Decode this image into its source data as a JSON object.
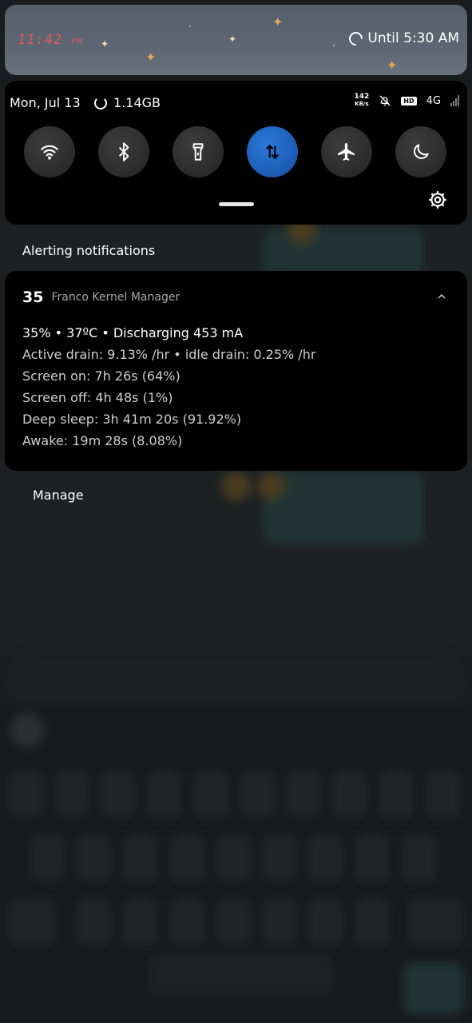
{
  "header": {
    "clock_time": "11:42",
    "clock_ampm": "PM",
    "alarm_text": "Until 5:30 AM"
  },
  "quick_settings": {
    "date": "Mon, Jul 13",
    "memory": "1.14GB",
    "net_speed_value": "142",
    "net_speed_unit": "KB/s",
    "hd_badge": "HD",
    "network_type": "4G",
    "tiles": [
      {
        "name": "wifi",
        "active": false
      },
      {
        "name": "bluetooth",
        "active": false
      },
      {
        "name": "flashlight",
        "active": false
      },
      {
        "name": "mobile-data",
        "active": true
      },
      {
        "name": "airplane-mode",
        "active": false
      },
      {
        "name": "dark-mode",
        "active": false
      }
    ],
    "accent_color": "#1e5fba"
  },
  "notifications": {
    "section_title": "Alerting notifications",
    "card": {
      "number": "35",
      "app_name": "Franco Kernel Manager",
      "lines": [
        "35% • 37ºC • Discharging 453 mA",
        "Active drain: 9.13% /hr • idle drain: 0.25% /hr",
        "Screen on: 7h 26s  (64%)",
        "Screen off: 4h 48s  (1%)",
        "Deep sleep: 3h 41m 20s  (91.92%)",
        "Awake: 19m 28s  (8.08%)"
      ]
    },
    "manage_label": "Manage"
  }
}
